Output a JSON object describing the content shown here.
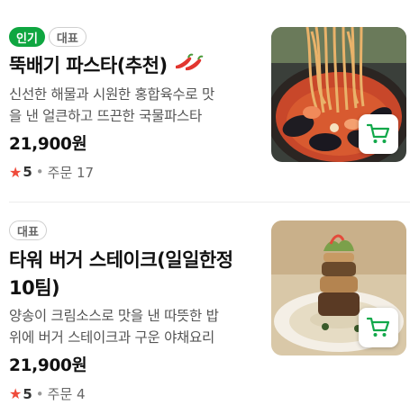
{
  "items": [
    {
      "badges": [
        "인기",
        "대표"
      ],
      "name": "뚝배기 파스타(추천)",
      "spicy_icon": "chili-pepper-icon",
      "description_line1": "신선한 해물과 시원한 홍합육수로 맛",
      "description_line2": "을 낸 얼큰하고 뜨끈한 국물파스타",
      "price": "21,900원",
      "rating": "5",
      "order_text": "주문 17",
      "cart_icon": "cart-icon"
    },
    {
      "badges": [
        "대표"
      ],
      "name_line1": "타워 버거 스테이크(일일한정",
      "name_line2": "10팀)",
      "description_line1": "양송이 크림소스로 맛을 낸 따뜻한 밥",
      "description_line2": "위에 버거 스테이크과 구운 야채요리",
      "price": "21,900원",
      "rating": "5",
      "order_text": "주문 4",
      "cart_icon": "cart-icon"
    }
  ],
  "colors": {
    "accent_green": "#0fa640",
    "star_red": "#ef4b3b"
  }
}
